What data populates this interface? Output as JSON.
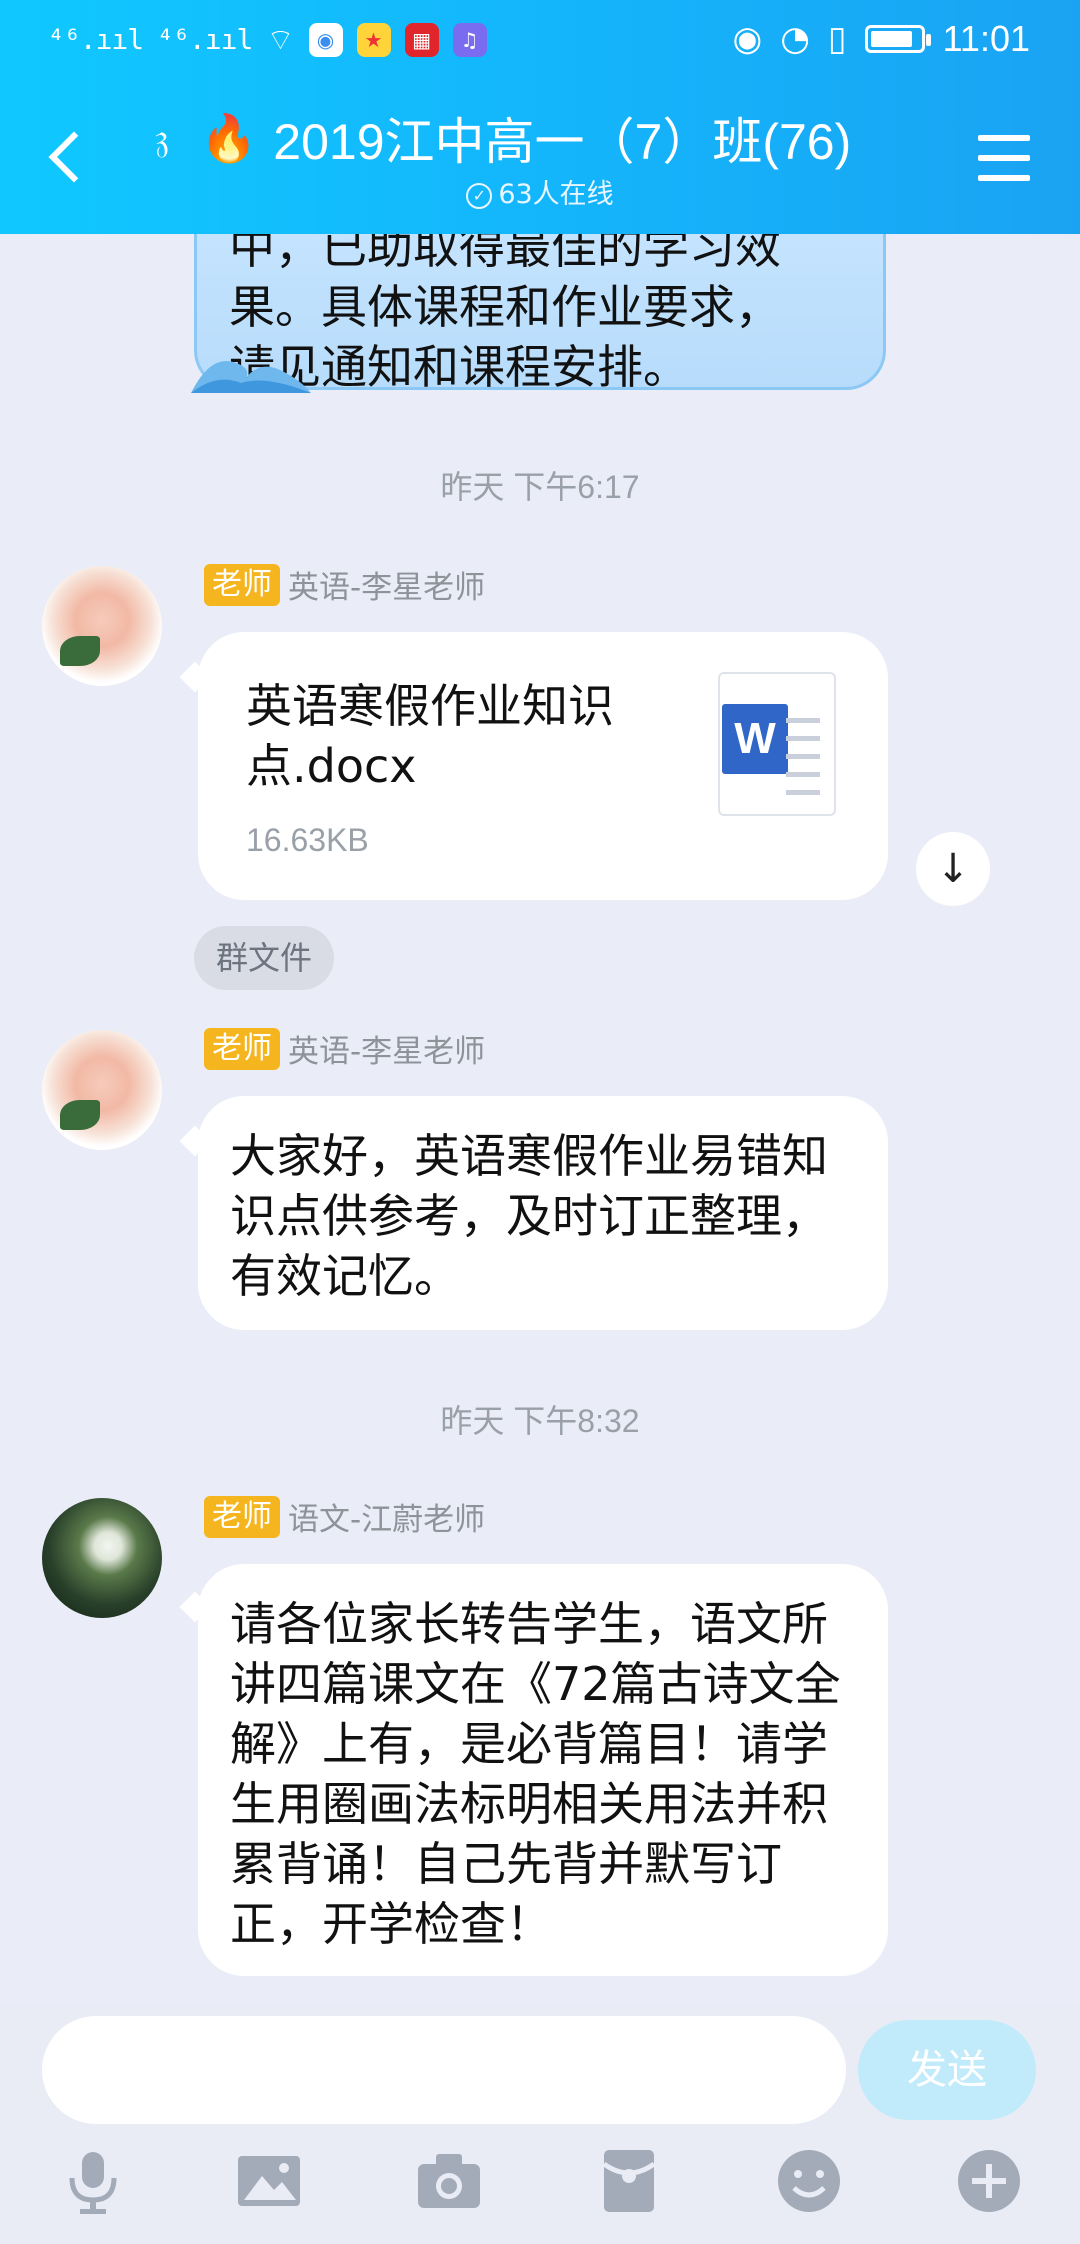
{
  "status_bar": {
    "signal_1": "⁴⁶.ııl",
    "signal_2": "⁴⁶.ııl",
    "time": "11:01",
    "battery_level": 0.85
  },
  "header": {
    "title": "2019江中高一（7）班(76)",
    "online": "63人在线"
  },
  "messages": {
    "prev_bubble_line1": "中，已助取得最佳的学习效",
    "prev_bubble_line2": "果。具体课程和作业要求，",
    "prev_bubble_line3": "请见通知和课程安排。",
    "time1": "昨天 下午6:17",
    "msg1": {
      "role": "老师",
      "sender": "英语-李星老师",
      "file_name": "英语寒假作业知识点.docx",
      "file_size": "16.63KB",
      "file_icon_letter": "W"
    },
    "group_file": "群文件",
    "msg2": {
      "role": "老师",
      "sender": "英语-李星老师",
      "text": "大家好，英语寒假作业易错知识点供参考，及时订正整理，有效记忆。"
    },
    "time2": "昨天 下午8:32",
    "msg3": {
      "role": "老师",
      "sender": "语文-江蔚老师",
      "text": "请各位家长转告学生，语文所讲四篇课文在《72篇古诗文全解》上有，是必背篇目！请学生用圈画法标明相关用法并积累背诵！自己先背并默写订正，开学检查！"
    }
  },
  "input": {
    "placeholder": "",
    "send_label": "发送"
  },
  "icons": [
    "back-icon",
    "ear-icon",
    "fire-icon",
    "menu-icon",
    "download-icon",
    "microphone-icon",
    "image-icon",
    "camera-icon",
    "red-packet-icon",
    "emoji-icon",
    "plus-icon"
  ],
  "colors": {
    "header_start": "#10c8ff",
    "header_end": "#1aa3f2",
    "role_tag": "#f5b51e",
    "chat_bg": "#eaedf7",
    "send_disabled": "#c1ebfb"
  }
}
